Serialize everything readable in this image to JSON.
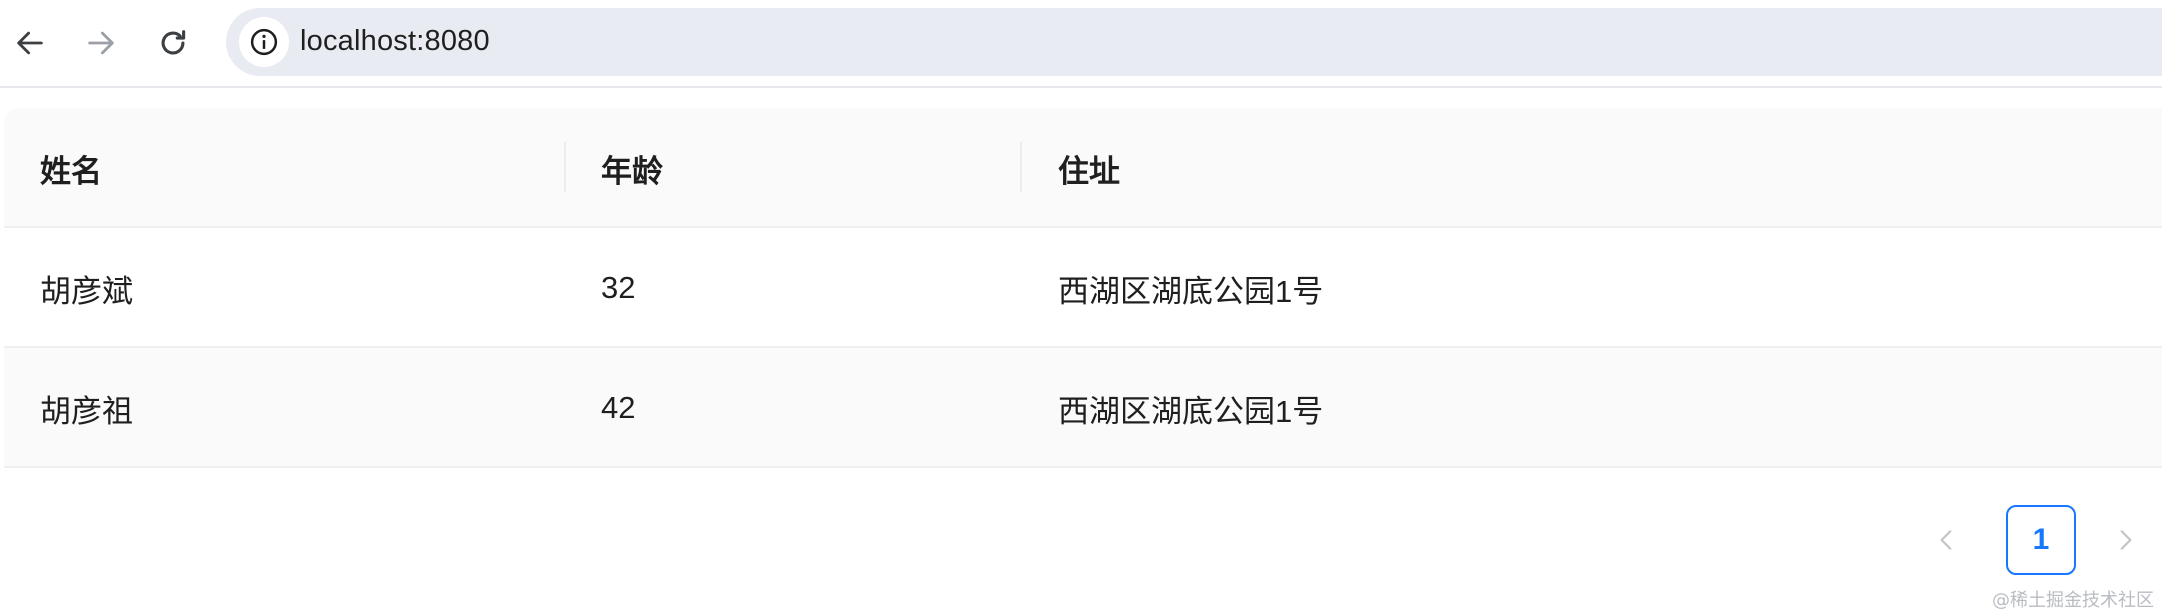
{
  "browser": {
    "url": "localhost:8080",
    "icons": [
      "arrow-left-icon",
      "arrow-right-icon",
      "reload-icon",
      "info-icon"
    ]
  },
  "table": {
    "columns": [
      "姓名",
      "年龄",
      "住址"
    ],
    "rows": [
      {
        "name": "胡彦斌",
        "age": "32",
        "address": "西湖区湖底公园1号"
      },
      {
        "name": "胡彦祖",
        "age": "42",
        "address": "西湖区湖底公园1号"
      }
    ]
  },
  "pagination": {
    "current_page": "1",
    "accent_color": "#1677ff"
  },
  "watermark": "@稀土掘金技术社区"
}
